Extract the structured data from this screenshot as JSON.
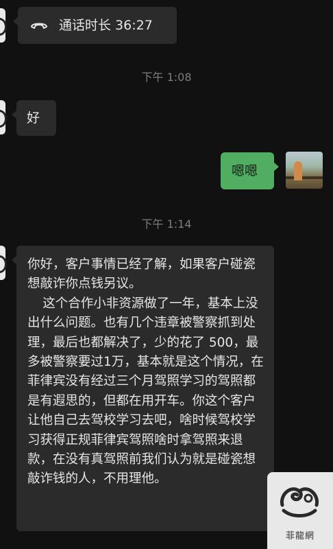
{
  "messages": {
    "call": {
      "label": "通话时长 36:27",
      "icon": "phone-hangup-icon"
    },
    "time1": "下午 1:08",
    "reply_left": "好",
    "reply_right": "嗯嗯",
    "time2": "下午 1:14",
    "long_text": {
      "p1": "你好，客户事情已经了解，如果客户碰瓷想敲诈你点钱另议。",
      "p2": "这个合作小非资源做了一年，基本上没出什么问题。也有几个违章被警察抓到处理，最后也都解决了，少的花了 500，最多被警察要过1万，基本就是这个情况，在菲律宾没有经过三个月驾照学习的驾照都是有遐思的，但都在用开车。你这个客户让他自己去驾校学习去吧，啥时候驾校学习获得正规菲律宾驾照啥时拿驾照来退款，在没有真驾照前我们认为就是碰瓷想敲诈钱的人，不用理他。"
    }
  },
  "watermark": {
    "text": "菲龍網"
  },
  "colors": {
    "background": "#111111",
    "bubble_dark": "#2b2b2b",
    "bubble_green": "#4fae5f",
    "timestamp": "#7d7d7d"
  }
}
